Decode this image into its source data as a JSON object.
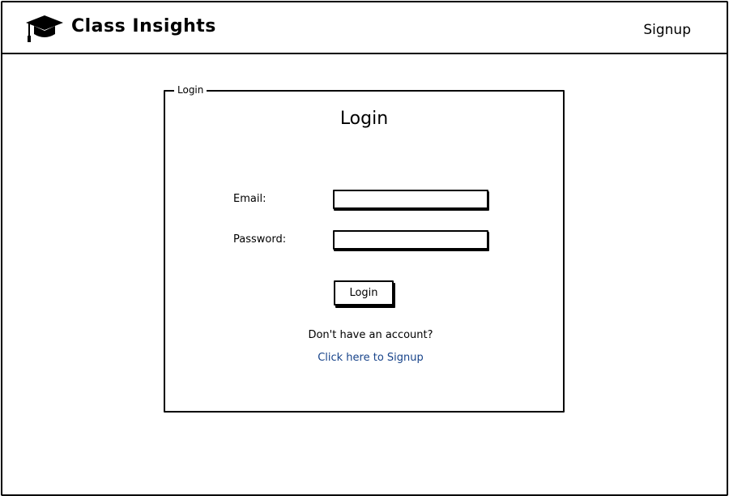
{
  "header": {
    "app_title": "Class Insights",
    "signup_label": "Signup",
    "logo_icon": "graduation-cap-icon"
  },
  "login_panel": {
    "legend": "Login",
    "title": "Login",
    "email_label": "Email:",
    "email_value": "",
    "password_label": "Password:",
    "password_value": "",
    "login_button_label": "Login",
    "no_account_text": "Don't have an account?",
    "signup_link_text": "Click here to Signup",
    "link_color": "#17438a"
  }
}
